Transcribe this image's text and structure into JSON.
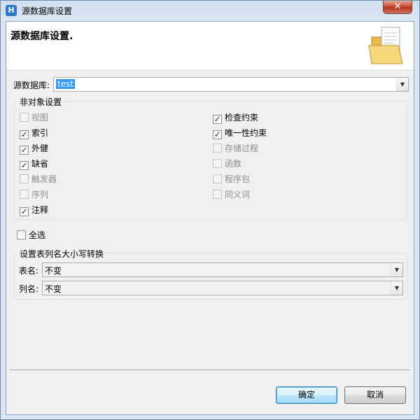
{
  "window": {
    "title": "源数据库设置",
    "close_glyph": "✕"
  },
  "header": {
    "title": "源数据库设置."
  },
  "database": {
    "label": "源数据库:",
    "value": "test"
  },
  "non_object": {
    "legend": "非对象设置",
    "left": [
      {
        "label": "视图",
        "checked": false,
        "enabled": false
      },
      {
        "label": "索引",
        "checked": true,
        "enabled": true
      },
      {
        "label": "外健",
        "checked": true,
        "enabled": true
      },
      {
        "label": "缺省",
        "checked": true,
        "enabled": true
      },
      {
        "label": "触发器",
        "checked": false,
        "enabled": false
      },
      {
        "label": "序列",
        "checked": false,
        "enabled": false
      },
      {
        "label": "注释",
        "checked": true,
        "enabled": true
      }
    ],
    "right": [
      {
        "label": "检查约束",
        "checked": true,
        "enabled": true
      },
      {
        "label": "唯一性约束",
        "checked": true,
        "enabled": true
      },
      {
        "label": "存储过程",
        "checked": false,
        "enabled": false
      },
      {
        "label": "函数",
        "checked": false,
        "enabled": false
      },
      {
        "label": "程序包",
        "checked": false,
        "enabled": false
      },
      {
        "label": "同义词",
        "checked": false,
        "enabled": false
      }
    ]
  },
  "select_all": {
    "label": "全选",
    "checked": false
  },
  "case_convert": {
    "legend": "设置表列名大小写转换",
    "table_label": "表名:",
    "table_value": "不变",
    "column_label": "列名:",
    "column_value": "不变"
  },
  "buttons": {
    "ok": "确定",
    "cancel": "取消"
  },
  "icons": {
    "app": "app-icon",
    "folder": "folder-icon",
    "dropdown": "chevron-down-icon"
  }
}
